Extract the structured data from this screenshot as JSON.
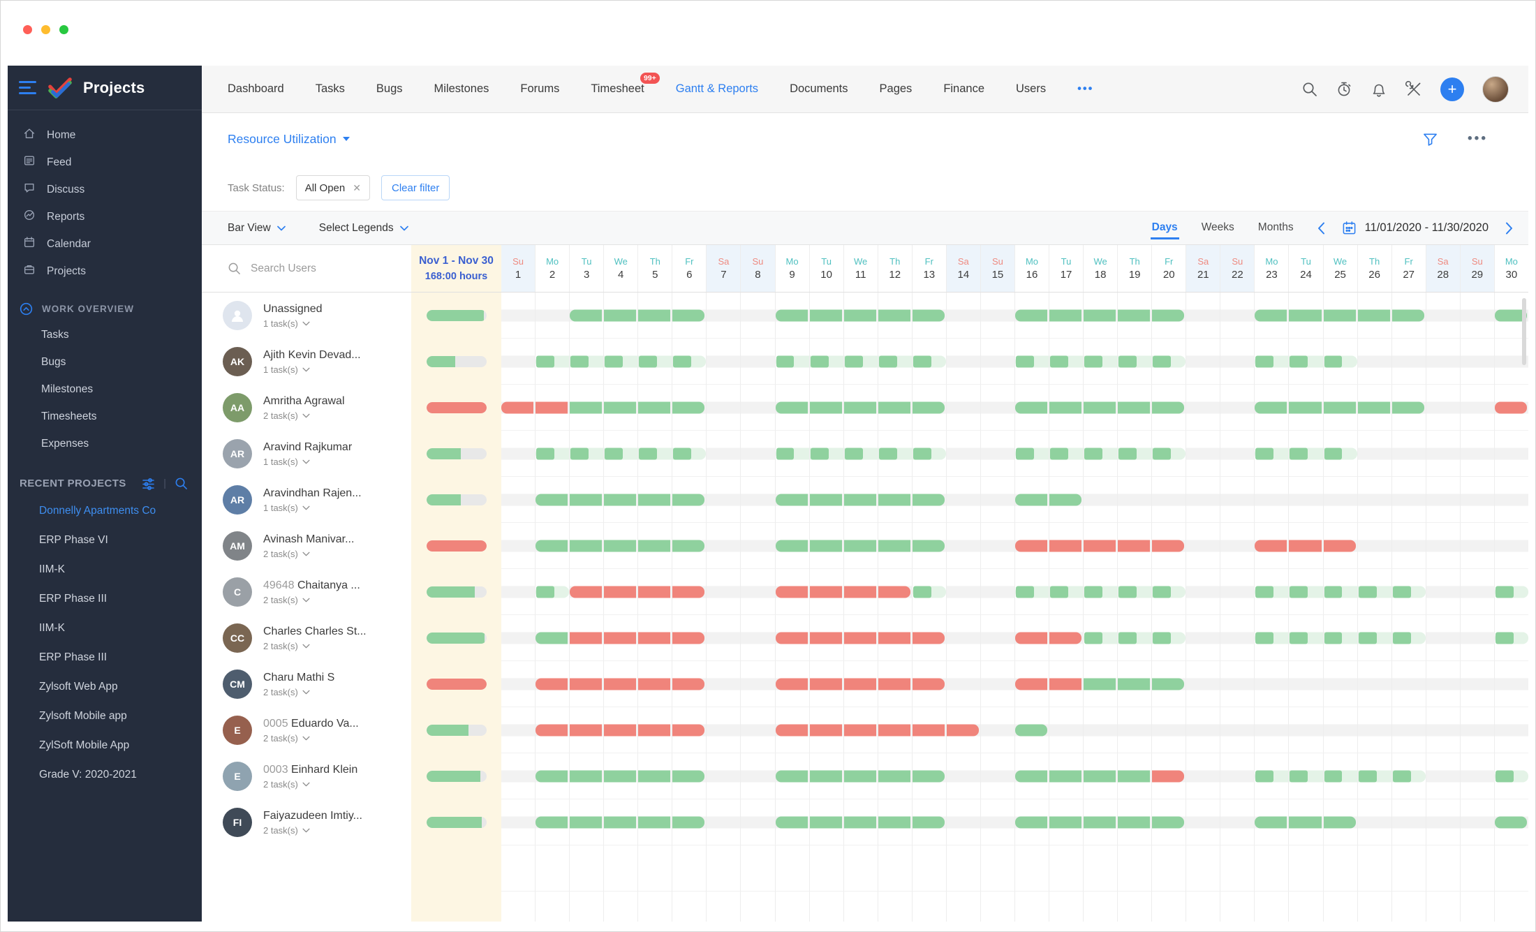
{
  "colors": {
    "accent": "#2d7ff0",
    "green": "#8fd19e",
    "palegreen": "#e4f3e7",
    "red": "#f0847b",
    "track": "#f2f2f2",
    "cream": "#fdf6e3",
    "weekend_bg": "#edf4fb",
    "teal": "#4fc0c0",
    "salmon": "#ee8a80",
    "header_blue": "#3a5fd0",
    "sidebar_bg": "#252d3d",
    "traffic_lights": [
      "#ff5f57",
      "#febc2e",
      "#28c840"
    ]
  },
  "sidebar": {
    "title": "Projects",
    "nav": [
      {
        "icon": "home",
        "label": "Home"
      },
      {
        "icon": "feed",
        "label": "Feed"
      },
      {
        "icon": "discuss",
        "label": "Discuss"
      },
      {
        "icon": "reports",
        "label": "Reports"
      },
      {
        "icon": "calendar",
        "label": "Calendar"
      },
      {
        "icon": "projects",
        "label": "Projects"
      }
    ],
    "work_overview": {
      "label": "WORK OVERVIEW",
      "items": [
        "Tasks",
        "Bugs",
        "Milestones",
        "Timesheets",
        "Expenses"
      ]
    },
    "recent": {
      "label": "RECENT PROJECTS",
      "items": [
        {
          "label": "Donnelly Apartments Co",
          "active": true
        },
        {
          "label": "ERP Phase VI",
          "active": false
        },
        {
          "label": "IIM-K",
          "active": false
        },
        {
          "label": "ERP Phase III",
          "active": false
        },
        {
          "label": "IIM-K",
          "active": false
        },
        {
          "label": "ERP Phase III",
          "active": false
        },
        {
          "label": "Zylsoft Web App",
          "active": false
        },
        {
          "label": "Zylsoft Mobile app",
          "active": false
        },
        {
          "label": "ZylSoft Mobile App",
          "active": false
        },
        {
          "label": "Grade V: 2020-2021",
          "active": false
        }
      ]
    }
  },
  "topnav": {
    "items": [
      {
        "label": "Dashboard",
        "active": false,
        "badge": ""
      },
      {
        "label": "Tasks",
        "active": false,
        "badge": ""
      },
      {
        "label": "Bugs",
        "active": false,
        "badge": ""
      },
      {
        "label": "Milestones",
        "active": false,
        "badge": ""
      },
      {
        "label": "Forums",
        "active": false,
        "badge": ""
      },
      {
        "label": "Timesheet",
        "active": false,
        "badge": "99+"
      },
      {
        "label": "Gantt & Reports",
        "active": true,
        "badge": ""
      },
      {
        "label": "Documents",
        "active": false,
        "badge": ""
      },
      {
        "label": "Pages",
        "active": false,
        "badge": ""
      },
      {
        "label": "Finance",
        "active": false,
        "badge": ""
      },
      {
        "label": "Users",
        "active": false,
        "badge": ""
      }
    ],
    "more": "•••"
  },
  "titlebar": {
    "title": "Resource Utilization",
    "more": "•••"
  },
  "filter": {
    "label": "Task Status:",
    "chip": "All Open",
    "chip_close": "✕",
    "clear": "Clear filter"
  },
  "toolbar": {
    "view": "Bar View",
    "legends": "Select Legends",
    "tabs": [
      {
        "label": "Days",
        "active": true
      },
      {
        "label": "Weeks",
        "active": false
      },
      {
        "label": "Months",
        "active": false
      }
    ],
    "date_range": "11/01/2020  -  11/30/2020"
  },
  "grid": {
    "search_placeholder": "Search Users",
    "range_title": "Nov 1 - Nov 30",
    "range_hours": "168:00 hours",
    "days": [
      {
        "dow": "Su",
        "num": "1",
        "weekend": true
      },
      {
        "dow": "Mo",
        "num": "2",
        "weekend": false
      },
      {
        "dow": "Tu",
        "num": "3",
        "weekend": false
      },
      {
        "dow": "We",
        "num": "4",
        "weekend": false
      },
      {
        "dow": "Th",
        "num": "5",
        "weekend": false
      },
      {
        "dow": "Fr",
        "num": "6",
        "weekend": false
      },
      {
        "dow": "Sa",
        "num": "7",
        "weekend": true
      },
      {
        "dow": "Su",
        "num": "8",
        "weekend": true
      },
      {
        "dow": "Mo",
        "num": "9",
        "weekend": false
      },
      {
        "dow": "Tu",
        "num": "10",
        "weekend": false
      },
      {
        "dow": "We",
        "num": "11",
        "weekend": false
      },
      {
        "dow": "Th",
        "num": "12",
        "weekend": false
      },
      {
        "dow": "Fr",
        "num": "13",
        "weekend": false
      },
      {
        "dow": "Sa",
        "num": "14",
        "weekend": true
      },
      {
        "dow": "Su",
        "num": "15",
        "weekend": true
      },
      {
        "dow": "Mo",
        "num": "16",
        "weekend": false
      },
      {
        "dow": "Tu",
        "num": "17",
        "weekend": false
      },
      {
        "dow": "We",
        "num": "18",
        "weekend": false
      },
      {
        "dow": "Th",
        "num": "19",
        "weekend": false
      },
      {
        "dow": "Fr",
        "num": "20",
        "weekend": false
      },
      {
        "dow": "Sa",
        "num": "21",
        "weekend": true
      },
      {
        "dow": "Su",
        "num": "22",
        "weekend": true
      },
      {
        "dow": "Mo",
        "num": "23",
        "weekend": false
      },
      {
        "dow": "Tu",
        "num": "24",
        "weekend": false
      },
      {
        "dow": "We",
        "num": "25",
        "weekend": false
      },
      {
        "dow": "Th",
        "num": "26",
        "weekend": false
      },
      {
        "dow": "Fr",
        "num": "27",
        "weekend": false
      },
      {
        "dow": "Sa",
        "num": "28",
        "weekend": true
      },
      {
        "dow": "Su",
        "num": "29",
        "weekend": true
      },
      {
        "dow": "Mo",
        "num": "30",
        "weekend": false
      }
    ],
    "users": [
      {
        "prefix": "",
        "name": "Unassigned",
        "tasks": "1 task(s)",
        "initials": "",
        "avatar": "#dfe5ee",
        "summary": {
          "color": "#8fd19e",
          "pct": 95
        },
        "cells": "--GGGG--GGGGG--GGGGG--GGGGG--G"
      },
      {
        "prefix": "",
        "name": "Ajith Kevin Devad...",
        "tasks": "1 task(s)",
        "initials": "AK",
        "avatar": "#6b5e52",
        "summary": {
          "color": "#8fd19e",
          "pct": 48
        },
        "cells": "-HHHHH--HHHHH--HHHHH--HHH-----"
      },
      {
        "prefix": "",
        "name": "Amritha Agrawal",
        "tasks": "2 task(s)",
        "initials": "AA",
        "avatar": "#7d9b6a",
        "summary": {
          "color": "#f0847b",
          "pct": 100
        },
        "cells": "RRGGGG--GGGGG--GGGGG--GGGGG--R"
      },
      {
        "prefix": "",
        "name": "Aravind Rajkumar",
        "tasks": "1 task(s)",
        "initials": "AR",
        "avatar": "#9aa3ad",
        "summary": {
          "color": "#8fd19e",
          "pct": 57
        },
        "cells": "-HHHHH--HHHHH--HHHHH--HHH-----"
      },
      {
        "prefix": "",
        "name": "Aravindhan Rajen...",
        "tasks": "1 task(s)",
        "initials": "AR",
        "avatar": "#5e7ea6",
        "summary": {
          "color": "#8fd19e",
          "pct": 57
        },
        "cells": "-GGGGG--GGGGG--GG-------------"
      },
      {
        "prefix": "",
        "name": "Avinash Manivar...",
        "tasks": "2 task(s)",
        "initials": "AM",
        "avatar": "#808488",
        "summary": {
          "color": "#f0847b",
          "pct": 100
        },
        "cells": "-GGGGG--GGGGG--RRRRR--RRR-----"
      },
      {
        "prefix": "49648 ",
        "name": "Chaitanya ...",
        "tasks": "2 task(s)",
        "initials": "C",
        "avatar": "#9aa0a6",
        "summary": {
          "color": "#8fd19e",
          "pct": 80
        },
        "cells": "-HRRRR--RRRRH--HHHHH--HHHHH--H"
      },
      {
        "prefix": "",
        "name": "Charles Charles St...",
        "tasks": "2 task(s)",
        "initials": "CC",
        "avatar": "#7a6652",
        "summary": {
          "color": "#8fd19e",
          "pct": 97
        },
        "cells": "-GRRRR--RRRRR--RRHHH--HHHHH--H"
      },
      {
        "prefix": "",
        "name": "Charu Mathi S",
        "tasks": "2 task(s)",
        "initials": "CM",
        "avatar": "#4e5d6e",
        "summary": {
          "color": "#f0847b",
          "pct": 100
        },
        "cells": "-RRRRR--RRRRR--RRGGG----------"
      },
      {
        "prefix": "0005 ",
        "name": "Eduardo Va...",
        "tasks": "2 task(s)",
        "initials": "E",
        "avatar": "#96604e",
        "summary": {
          "color": "#8fd19e",
          "pct": 70
        },
        "cells": "-RRRRR--RRRRRR-G--------------"
      },
      {
        "prefix": "0003 ",
        "name": "Einhard Klein",
        "tasks": "2 task(s)",
        "initials": "E",
        "avatar": "#8fa3b0",
        "summary": {
          "color": "#8fd19e",
          "pct": 90
        },
        "cells": "-GGGGG--GGGGG--GGGGR--HHHHH--H"
      },
      {
        "prefix": "",
        "name": "Faiyazudeen Imtiy...",
        "tasks": "2 task(s)",
        "initials": "FI",
        "avatar": "#3f4a57",
        "summary": {
          "color": "#8fd19e",
          "pct": 92
        },
        "cells": "-GGGGG--GGGGG--GGGGG--GGG----G"
      }
    ]
  }
}
